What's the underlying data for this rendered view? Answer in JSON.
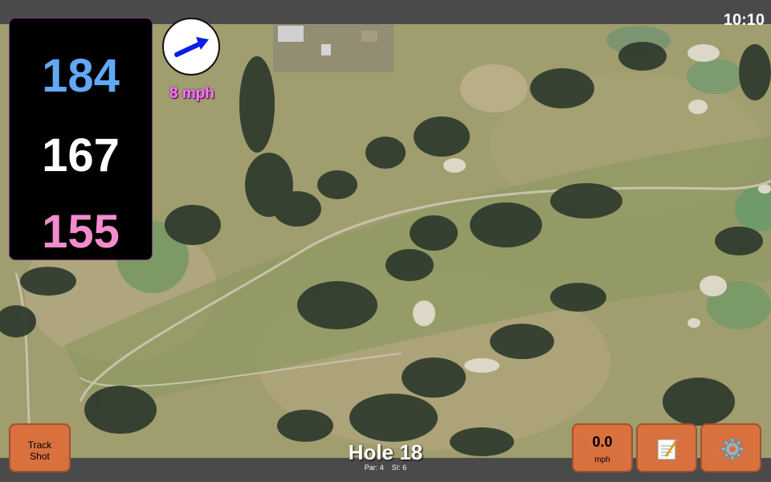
{
  "status_bar": {
    "time": "10:10"
  },
  "distances": {
    "back": "184",
    "middle": "167",
    "front": "155"
  },
  "wind": {
    "speed_label": "8 mph",
    "arrow_icon": "wind-arrow-icon",
    "arrow_color": "#0a1ee6"
  },
  "buttons": {
    "track_shot_line1": "Track",
    "track_shot_line2": "Shot",
    "speed_value": "0.0",
    "speed_unit": "mph",
    "notes_icon": "notepad-icon",
    "settings_icon": "gear-icon"
  },
  "hole": {
    "title": "Hole 18",
    "par": "Par: 4",
    "si": "SI: 6"
  },
  "colors": {
    "back_distance": "#61a9f4",
    "middle_distance": "#ffffff",
    "front_distance": "#f28ccc",
    "button_bg": "#d9713f",
    "bar_bg": "#4a4a4a"
  }
}
